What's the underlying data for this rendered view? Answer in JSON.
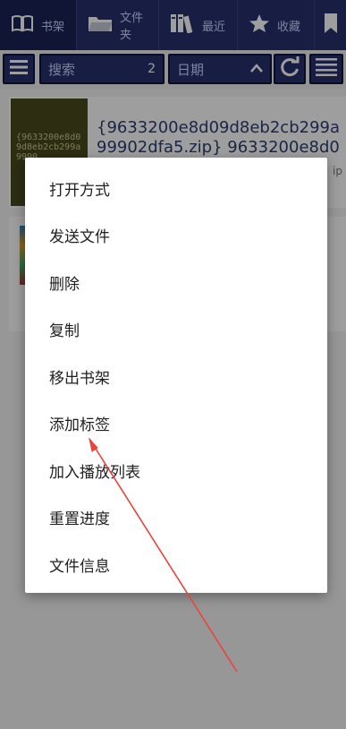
{
  "tabs": [
    {
      "label": "书架",
      "icon": "book-open-icon",
      "active": true
    },
    {
      "label": "文件夹",
      "icon": "folder-icon",
      "active": false
    },
    {
      "label": "最近",
      "icon": "books-icon",
      "active": false
    },
    {
      "label": "收藏",
      "icon": "star-icon",
      "active": false
    }
  ],
  "toolbar": {
    "search_label": "搜索",
    "search_count": "2",
    "sort_label": "日期"
  },
  "books": [
    {
      "cover_text": "{9633200e8d09d8eb2cb299a9990",
      "title": "{9633200e8d09d8eb2cb299a99902dfa5.zip} 9633200e8d09d8e…",
      "ext": "ip"
    }
  ],
  "menu": {
    "items": [
      "打开方式",
      "发送文件",
      "删除",
      "复制",
      "移出书架",
      "添加标签",
      "加入播放列表",
      "重置进度",
      "文件信息"
    ]
  },
  "colors": {
    "accent": "#27306e",
    "annotation_arrow": "#e8453c"
  }
}
